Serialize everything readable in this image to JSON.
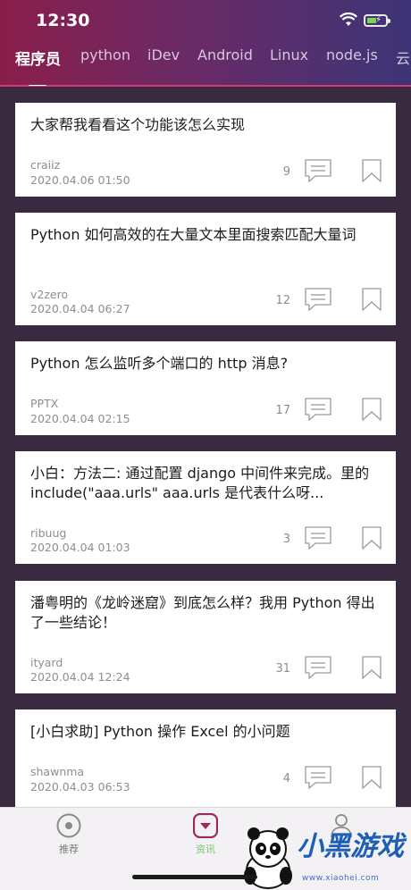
{
  "status_bar": {
    "time": "12:30"
  },
  "tabs": [
    {
      "label": "程序员"
    },
    {
      "label": "python"
    },
    {
      "label": "iDev"
    },
    {
      "label": "Android"
    },
    {
      "label": "Linux"
    },
    {
      "label": "node.js"
    },
    {
      "label": "云"
    }
  ],
  "posts": [
    {
      "title": "大家帮我看看这个功能该怎么实现",
      "author": "craiiz",
      "date": "2020.04.06 01:50",
      "comments": "9"
    },
    {
      "title": "Python 如何高效的在大量文本里面搜索匹配大量词",
      "author": "v2zero",
      "date": "2020.04.04 06:27",
      "comments": "12"
    },
    {
      "title": "Python 怎么监听多个端口的 http 消息?",
      "author": "PPTX",
      "date": "2020.04.04 02:15",
      "comments": "17"
    },
    {
      "title": "小白：方法二: 通过配置 django 中间件来完成。里的 include(\"aaa.urls\" aaa.urls 是代表什么呀...",
      "author": "ribuug",
      "date": "2020.04.04 01:03",
      "comments": "3"
    },
    {
      "title": "潘粤明的《龙岭迷窟》到底怎么样？我用 Python 得出了一些结论！",
      "author": "ityard",
      "date": "2020.04.04 12:24",
      "comments": "31"
    },
    {
      "title": "[小白求助] Python 操作 Excel 的小问题",
      "author": "shawnma",
      "date": "2020.04.03 06:53",
      "comments": "4"
    }
  ],
  "tabbar": [
    {
      "label": "推荐",
      "icon": "target-icon"
    },
    {
      "label": "资讯",
      "icon": "news-icon"
    },
    {
      "label": "",
      "icon": "user-icon"
    }
  ],
  "watermark": {
    "text": "小黑游戏",
    "url": "www.xiaohei.com"
  },
  "colors": {
    "accent": "#d23a73",
    "active_tab": "#76c66b",
    "background": "#3a2a3f"
  }
}
